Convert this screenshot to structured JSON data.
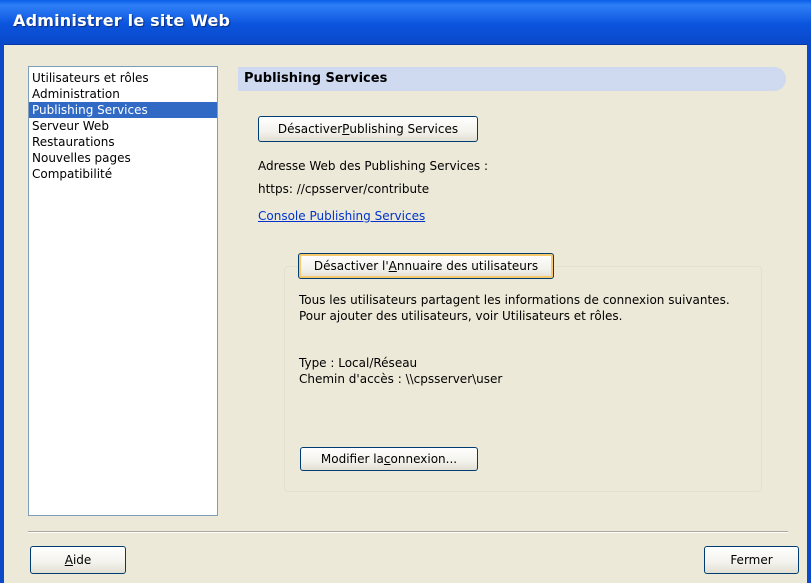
{
  "window": {
    "title": "Administrer le site Web"
  },
  "sidebar": {
    "items": [
      {
        "label": "Utilisateurs et rôles"
      },
      {
        "label": "Administration"
      },
      {
        "label": "Publishing Services",
        "selected": true
      },
      {
        "label": "Serveur Web"
      },
      {
        "label": "Restaurations"
      },
      {
        "label": "Nouvelles pages"
      },
      {
        "label": "Compatibilité"
      }
    ]
  },
  "panel": {
    "header": "Publishing Services",
    "deactivate_button": {
      "pre": "Désactiver ",
      "mnemonic": "P",
      "post": "ublishing Services"
    },
    "address_label": "Adresse Web des Publishing Services :",
    "address_value": "https: //cpsserver/contribute",
    "console_link": "Console Publishing Services",
    "directory": {
      "deactivate_button": {
        "pre": "Désactiver l'",
        "mnemonic": "A",
        "post": "nnuaire des utilisateurs"
      },
      "description": "Tous les utilisateurs partagent les informations de connexion suivantes. Pour ajouter des utilisateurs, voir Utilisateurs et rôles.",
      "type": "Type : Local/Réseau",
      "path": "Chemin d'accès : \\\\cpsserver\\user",
      "modify_button": {
        "pre": "Modifier la ",
        "mnemonic": "c",
        "post": "onnexion..."
      }
    }
  },
  "footer": {
    "help_button": {
      "pre": "",
      "mnemonic": "A",
      "post": "ide"
    },
    "close_button": "Fermer"
  }
}
